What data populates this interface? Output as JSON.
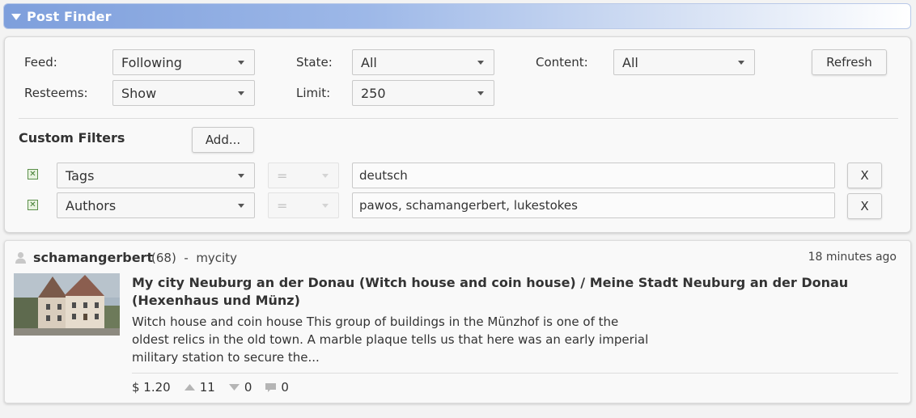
{
  "header": {
    "title": "Post Finder",
    "toggle_icon": "triangle-down-icon"
  },
  "filters": {
    "feed": {
      "label": "Feed:",
      "value": "Following"
    },
    "state": {
      "label": "State:",
      "value": "All"
    },
    "content": {
      "label": "Content:",
      "value": "All"
    },
    "refresh_label": "Refresh",
    "resteems": {
      "label": "Resteems:",
      "value": "Show"
    },
    "limit": {
      "label": "Limit:",
      "value": "250"
    }
  },
  "custom_filters": {
    "title": "Custom Filters",
    "add_label": "Add...",
    "rows": [
      {
        "field": "Tags",
        "operator": "=",
        "value": "deutsch",
        "remove_label": "X",
        "checked": true
      },
      {
        "field": "Authors",
        "operator": "=",
        "value": "pawos, schamangerbert, lukestokes",
        "remove_label": "X",
        "checked": true
      }
    ]
  },
  "post": {
    "author": "schamangerbert",
    "reputation": "(68)",
    "separator": "-",
    "category": "mycity",
    "time_ago": "18 minutes ago",
    "title": "My city Neuburg an der Donau (Witch house and coin house) / Meine Stadt Neuburg an der Donau (Hexenhaus und Münz)",
    "excerpt": "Witch house and coin house This group of buildings in the Münzhof is one of the oldest relics in the old town. A marble plaque tells us that here was an early imperial military station to secure the...",
    "payout": "$ 1.20",
    "upvotes": "11",
    "downvotes": "0",
    "comments": "0"
  },
  "colors": {
    "header_start": "#7e9fdc",
    "header_end": "#ffffff",
    "check_green": "#5b8f4a"
  }
}
